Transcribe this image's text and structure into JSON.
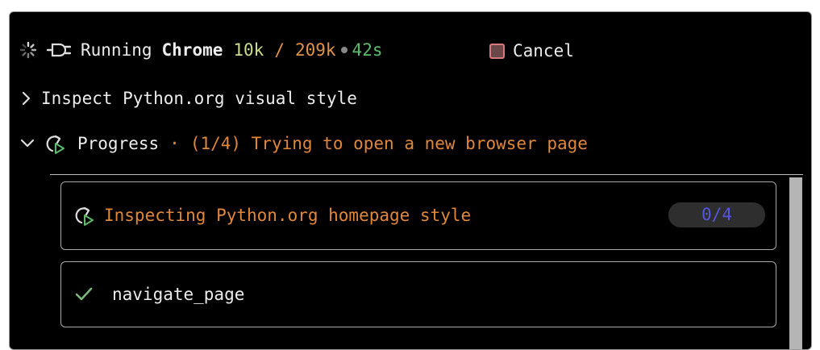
{
  "status": {
    "running_label": "Running",
    "app_name": "Chrome",
    "tokens_used": "10k",
    "separator": "/",
    "tokens_total": "209k",
    "elapsed": "42s",
    "cancel_label": "Cancel"
  },
  "task": {
    "title": "Inspect Python.org visual style"
  },
  "progress": {
    "label": "Progress",
    "separator": "·",
    "step_text": "(1/4) Trying to open a new browser page"
  },
  "subtask": {
    "title": "Inspecting Python.org homepage style",
    "count": "0/4"
  },
  "steps": [
    {
      "label": "navigate_page",
      "status": "done"
    }
  ],
  "colors": {
    "background": "#000000",
    "text": "#ececec",
    "tokens_used": "#c9de8a",
    "tokens_total": "#e0934a",
    "elapsed": "#5dbb6b",
    "progress_accent": "#e0873a",
    "counter": "#5555e0",
    "check": "#7bb87b",
    "cancel_border": "#d97a7a"
  },
  "icons": {
    "spinner": "spinner-icon",
    "plug": "plug-icon",
    "collapsed": "chevron-right-icon",
    "expanded": "chevron-down-icon",
    "progress": "refresh-play-icon",
    "check": "check-icon",
    "cancel": "stop-square-icon"
  }
}
